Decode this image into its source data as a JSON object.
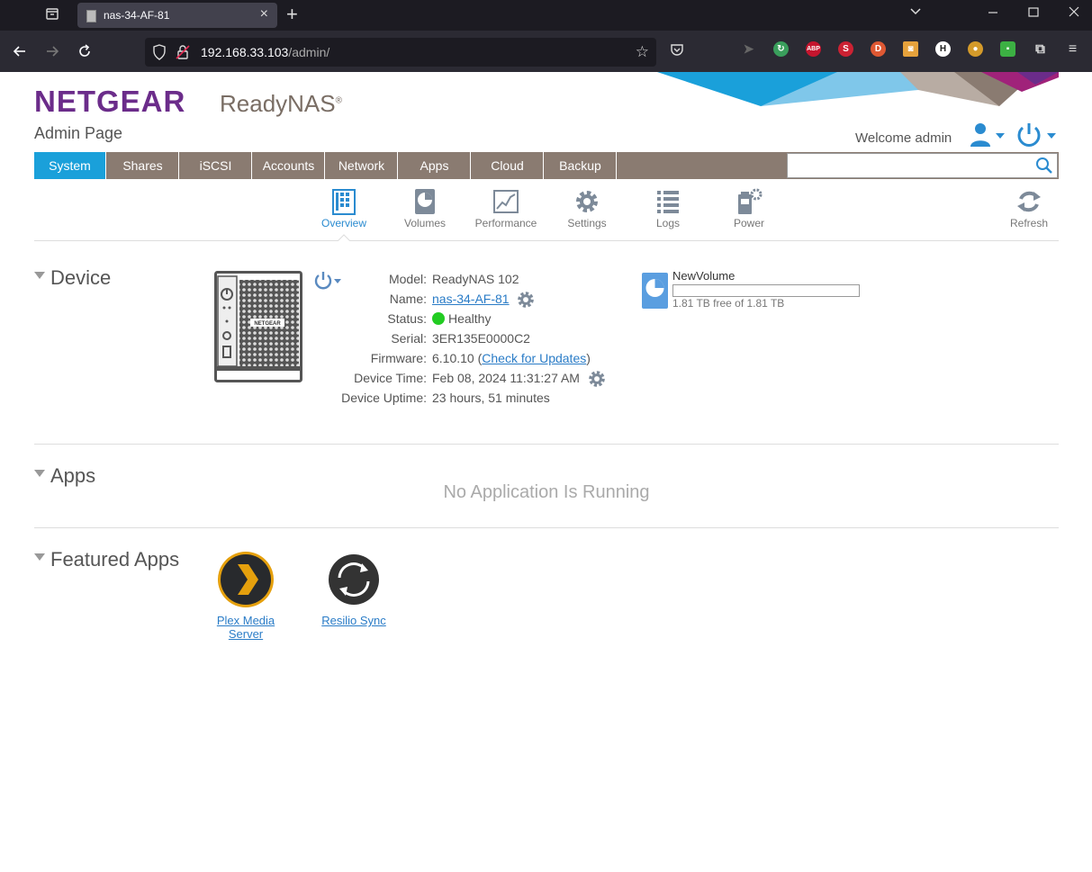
{
  "browser": {
    "tab_title": "nas-34-AF-81",
    "url_host": "192.168.33.103",
    "url_path": "/admin/"
  },
  "header": {
    "brand": "NETGEAR",
    "product": "ReadyNAS",
    "product_mark": "®",
    "subtitle": "Admin Page",
    "welcome": "Welcome admin"
  },
  "mainnav": {
    "items": [
      {
        "label": "System"
      },
      {
        "label": "Shares"
      },
      {
        "label": "iSCSI"
      },
      {
        "label": "Accounts"
      },
      {
        "label": "Network"
      },
      {
        "label": "Apps"
      },
      {
        "label": "Cloud"
      },
      {
        "label": "Backup"
      }
    ],
    "active": "System",
    "search_value": ""
  },
  "subnav": {
    "items": [
      {
        "label": "Overview",
        "icon": "overview-icon"
      },
      {
        "label": "Volumes",
        "icon": "volumes-icon"
      },
      {
        "label": "Performance",
        "icon": "performance-icon"
      },
      {
        "label": "Settings",
        "icon": "settings-icon"
      },
      {
        "label": "Logs",
        "icon": "logs-icon"
      },
      {
        "label": "Power",
        "icon": "power-icon"
      }
    ],
    "refresh_label": "Refresh"
  },
  "device": {
    "section_title": "Device",
    "nas_badge": "NETGEAR",
    "fields": {
      "model_label": "Model:",
      "model": "ReadyNAS 102",
      "name_label": "Name:",
      "name": "nas-34-AF-81",
      "status_label": "Status:",
      "status": "Healthy",
      "serial_label": "Serial:",
      "serial": "3ER135E0000C2",
      "firmware_label": "Firmware:",
      "firmware": "6.10.10",
      "firmware_open": "(",
      "firmware_link": "Check for Updates",
      "firmware_close": ")",
      "time_label": "Device Time:",
      "time": "Feb 08, 2024 11:31:27 AM",
      "uptime_label": "Device Uptime:",
      "uptime": "23 hours, 51 minutes"
    },
    "volume": {
      "name": "NewVolume",
      "free_text": "1.81 TB free of 1.81 TB",
      "used_fraction": 0
    }
  },
  "apps": {
    "section_title": "Apps",
    "empty_text": "No Application Is Running"
  },
  "featured": {
    "section_title": "Featured Apps",
    "items": [
      {
        "label_line1": "Plex Media",
        "label_line2": "Server"
      },
      {
        "label_line1": "Resilio Sync",
        "label_line2": ""
      }
    ]
  }
}
